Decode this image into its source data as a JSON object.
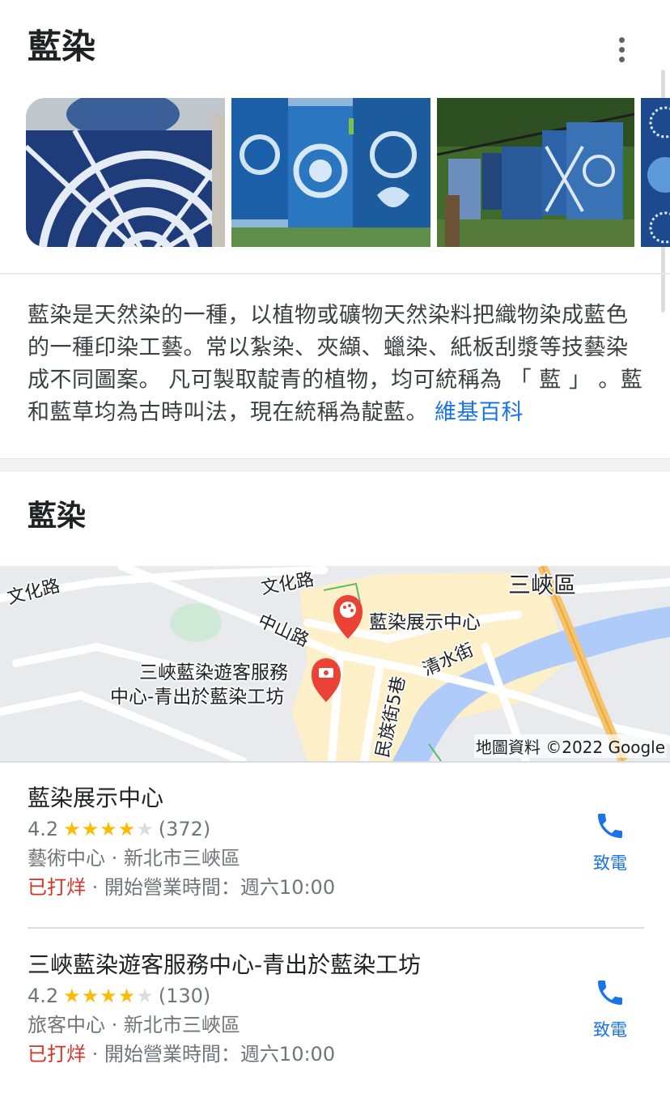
{
  "knowledge_panel": {
    "title": "藍染",
    "more_icon": "more-vert-icon",
    "images": [
      {
        "name": "tie-dye-cloth-held-up"
      },
      {
        "name": "indigo-cloths-hanging"
      },
      {
        "name": "indigo-cloths-on-line-outdoors"
      },
      {
        "name": "indigo-circle-pattern"
      }
    ],
    "description": "藍染是天然染的一種，以植物或礦物天然染料把織物染成藍色的一種印染工藝。常以紮染、夾纈、蠟染、紙板刮漿等技藝染成不同圖案。 凡可製取靛青的植物，均可統稱為 「 藍 」 。藍和藍草均為古時叫法，現在統稱為靛藍。",
    "source_link": "維基百科"
  },
  "local": {
    "title": "藍染",
    "map": {
      "labels": {
        "road_wenhua_1": "文化路",
        "road_wenhua_2": "文化路",
        "road_zhongshan": "中山路",
        "road_qingshui": "清水街",
        "road_minzu": "民族街5巷",
        "district": "三峽區",
        "poi_1": "藍染展示中心",
        "poi_2_line1": "三峽藍染遊客服務",
        "poi_2_line2": "中心-青出於藍染工坊"
      },
      "attribution": "地圖資料 ©2022 Google",
      "colors": {
        "pin": "#ea4335",
        "water": "#aecbfa",
        "park": "#ceead6",
        "highway": "#f6c26b"
      }
    },
    "places": [
      {
        "name": "藍染展示中心",
        "rating": "4.2",
        "stars_filled": 4,
        "stars_total": 5,
        "reviews": "(372)",
        "category": "藝術中心",
        "sep": "·",
        "location": "新北市三峽區",
        "status": "已打烊",
        "hours": "開始營業時間：週六10:00",
        "call_label": "致電"
      },
      {
        "name": "三峽藍染遊客服務中心-青出於藍染工坊",
        "rating": "4.2",
        "stars_filled": 4,
        "stars_total": 5,
        "reviews": "(130)",
        "category": "旅客中心",
        "sep": "·",
        "location": "新北市三峽區",
        "status": "已打烊",
        "hours": "開始營業時間：週六10:00",
        "call_label": "致電"
      }
    ]
  }
}
